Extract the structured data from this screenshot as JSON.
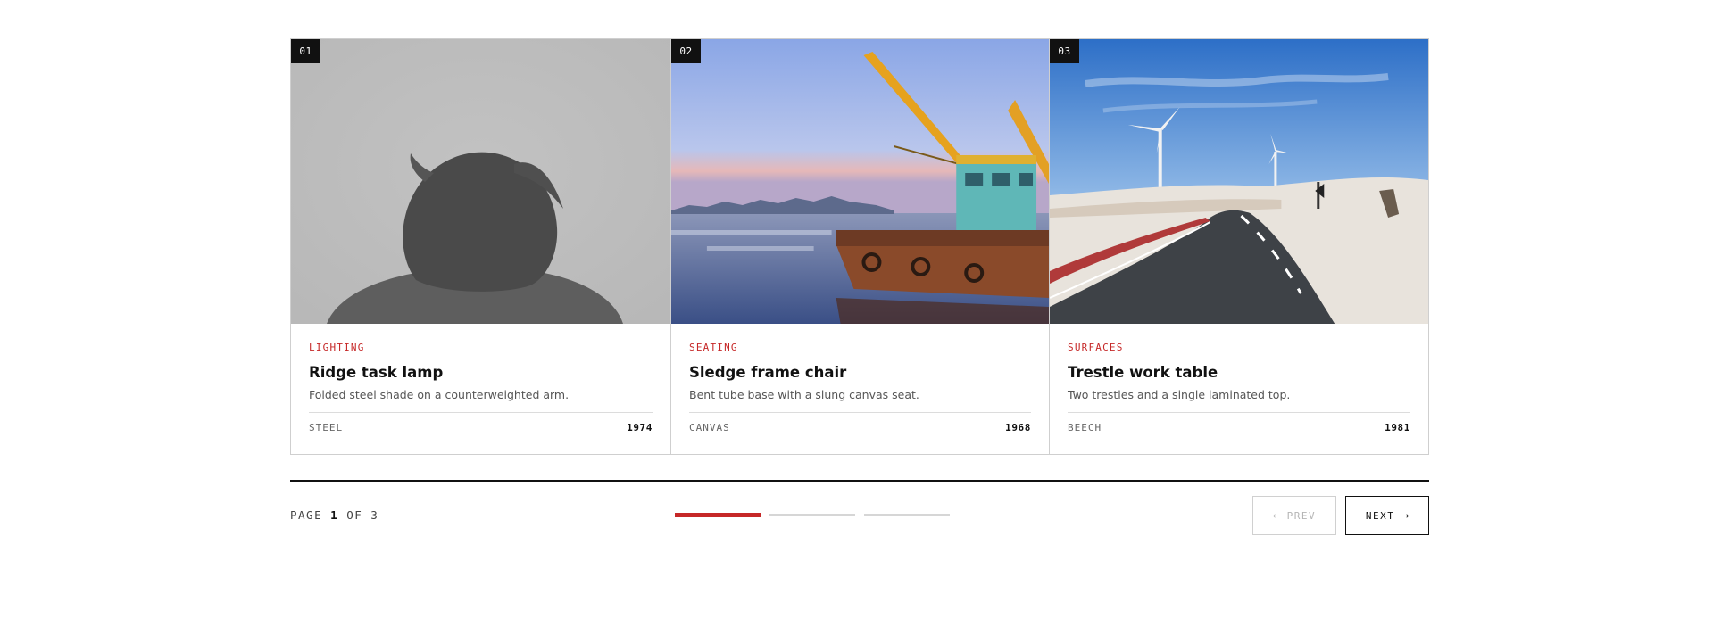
{
  "cards": [
    {
      "number": "01",
      "category": "LIGHTING",
      "title": "Ridge task lamp",
      "description": "Folded steel shade on a counterweighted arm.",
      "material": "STEEL",
      "year": "1974"
    },
    {
      "number": "02",
      "category": "SEATING",
      "title": "Sledge frame chair",
      "description": "Bent tube base with a slung canvas seat.",
      "material": "CANVAS",
      "year": "1968"
    },
    {
      "number": "03",
      "category": "SURFACES",
      "title": "Trestle work table",
      "description": "Two trestles and a single laminated top.",
      "material": "BEECH",
      "year": "1981"
    }
  ],
  "pagination": {
    "page_label": "PAGE",
    "current_page": "1",
    "of_label": "OF",
    "total_pages": "3",
    "prev_label": "PREV",
    "next_label": "NEXT",
    "prev_disabled": true
  },
  "colors": {
    "accent": "#c62828",
    "ink": "#111111",
    "border": "#cfcfcf"
  },
  "icons": {
    "prev": "arrow-left-icon",
    "next": "arrow-right-icon"
  }
}
